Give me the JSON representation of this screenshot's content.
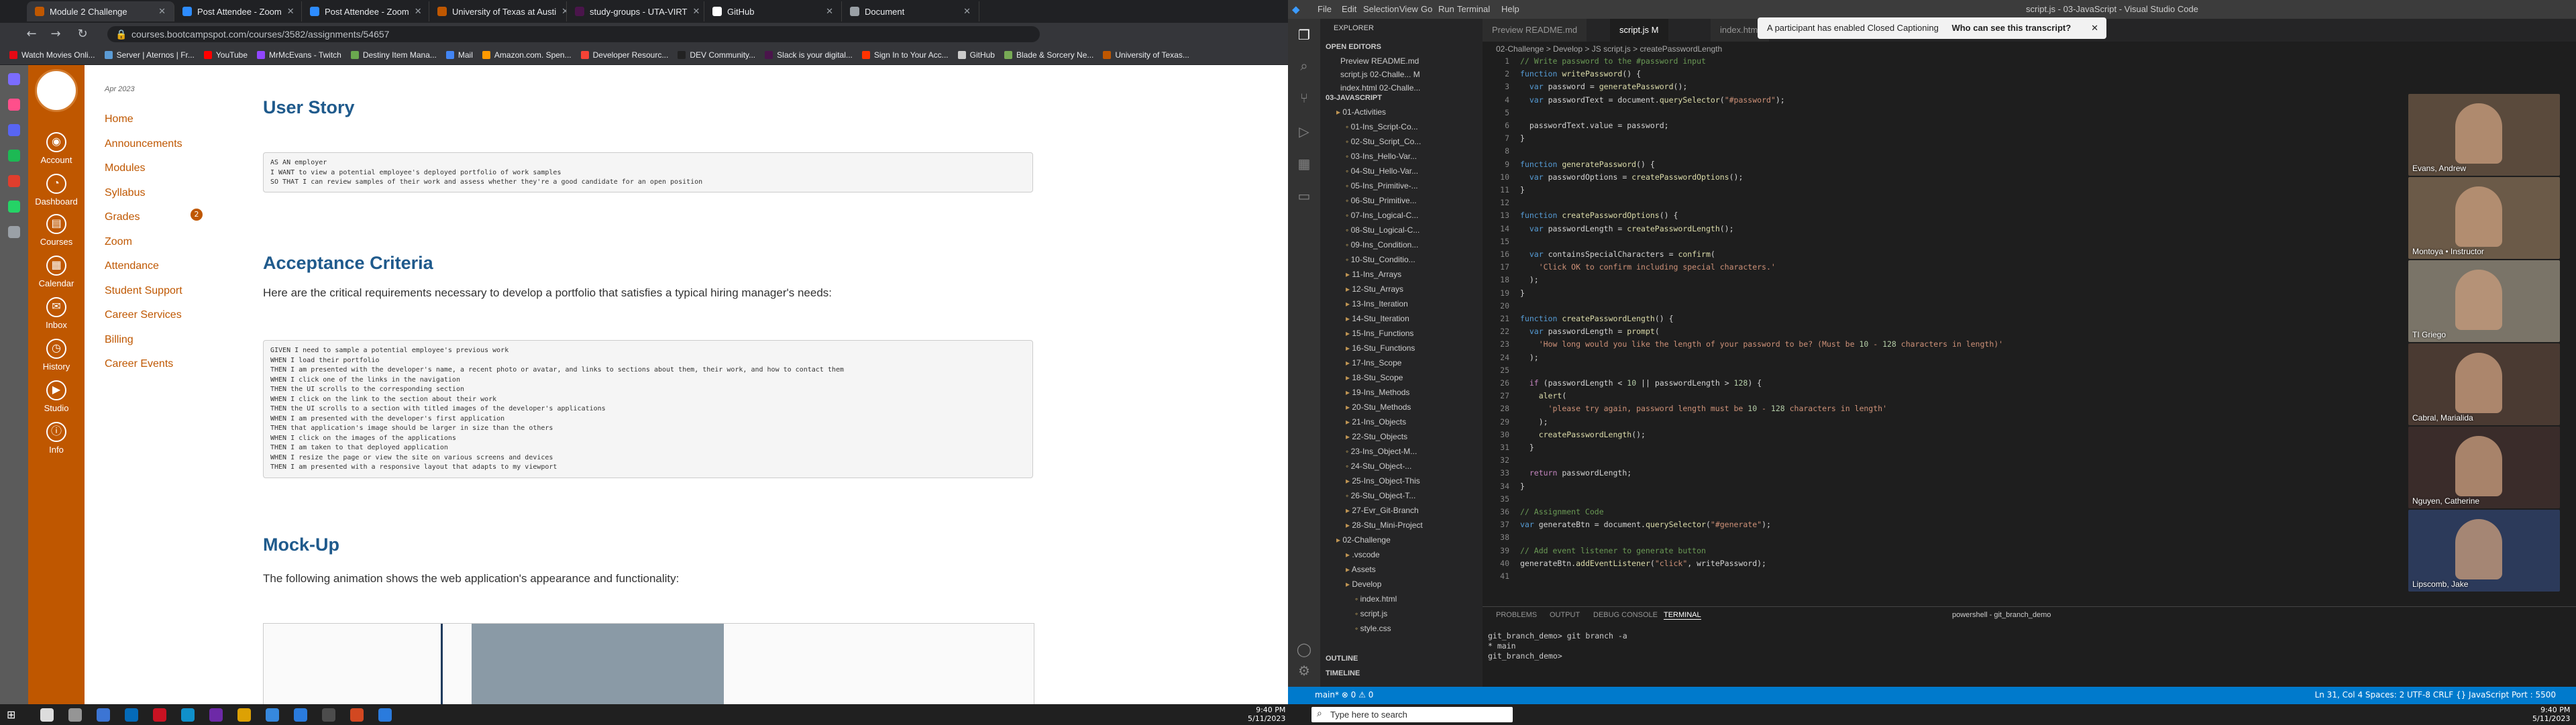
{
  "browser": {
    "tabs": [
      {
        "label": "Module 2 Challenge",
        "color": "#bf5700",
        "active": true
      },
      {
        "label": "Post Attendee - Zoom",
        "color": "#2d8cff"
      },
      {
        "label": "Post Attendee - Zoom",
        "color": "#2d8cff"
      },
      {
        "label": "University of Texas at Austi",
        "color": "#bf5700"
      },
      {
        "label": "study-groups - UTA-VIRT",
        "color": "#4a154b"
      },
      {
        "label": "GitHub",
        "color": "#ffffff"
      },
      {
        "label": "Document",
        "color": "#9aa0a6"
      }
    ],
    "url": "courses.bootcampspot.com/courses/3582/assignments/54657",
    "bookmarks": [
      "Watch Movies Onli...",
      "Server | Aternos | Fr...",
      "YouTube",
      "MrMcEvans - Twitch",
      "Destiny Item Mana...",
      "Mail",
      "Amazon.com. Spen...",
      "Developer Resourc...",
      "DEV Community...",
      "Slack is your digital...",
      "Sign In to Your Acc...",
      "GitHub",
      "Blade & Sorcery Ne...",
      "University of Texas..."
    ]
  },
  "canvas": {
    "global_nav": [
      "Account",
      "Dashboard",
      "Courses",
      "Calendar",
      "Inbox",
      "History",
      "Studio",
      "Info"
    ],
    "term": "Apr 2023",
    "course_nav": [
      "Home",
      "Announcements",
      "Modules",
      "Syllabus",
      "Grades",
      "Zoom",
      "Attendance",
      "Student Support",
      "Career Services",
      "Billing",
      "Career Events"
    ],
    "grades_badge": "2",
    "sections": {
      "user_story_title": "User Story",
      "user_story_code": "AS AN employer\nI WANT to view a potential employee's deployed portfolio of work samples\nSO THAT I can review samples of their work and assess whether they're a good candidate for an open position",
      "acceptance_title": "Acceptance Criteria",
      "acceptance_intro": "Here are the critical requirements necessary to develop a portfolio that satisfies a typical hiring manager's needs:",
      "acceptance_code": "GIVEN I need to sample a potential employee's previous work\nWHEN I load their portfolio\nTHEN I am presented with the developer's name, a recent photo or avatar, and links to sections about them, their work, and how to contact them\nWHEN I click one of the links in the navigation\nTHEN the UI scrolls to the corresponding section\nWHEN I click on the link to the section about their work\nTHEN the UI scrolls to a section with titled images of the developer's applications\nWHEN I am presented with the developer's first application\nTHEN that application's image should be larger in size than the others\nWHEN I click on the images of the applications\nTHEN I am taken to that deployed application\nWHEN I resize the page or view the site on various screens and devices\nTHEN I am presented with a responsive layout that adapts to my viewport",
      "mockup_title": "Mock-Up",
      "mockup_intro": "The following animation shows the web application's appearance and functionality:"
    }
  },
  "vscode": {
    "title": "script.js - 03-JavaScript - Visual Studio Code",
    "menu": [
      "File",
      "Edit",
      "Selection",
      "View",
      "Go",
      "Run",
      "Terminal",
      "Help"
    ],
    "explorer_title": "EXPLORER",
    "open_editors_label": "OPEN EDITORS",
    "open_editors": [
      "Preview README.md",
      "script.js  02-Challe...  M",
      "index.html  02-Challe..."
    ],
    "root_label": "03-JAVASCRIPT",
    "tree": [
      "01-Activities",
      "01-Ins_Script-Co...",
      "02-Stu_Script_Co...",
      "03-Ins_Hello-Var...",
      "04-Stu_Hello-Var...",
      "05-Ins_Primitive-...",
      "06-Stu_Primitive...",
      "07-Ins_Logical-C...",
      "08-Stu_Logical-C...",
      "09-Ins_Condition...",
      "10-Stu_Conditio...",
      "11-Ins_Arrays",
      "12-Stu_Arrays",
      "13-Ins_Iteration",
      "14-Stu_Iteration",
      "15-Ins_Functions",
      "16-Stu_Functions",
      "17-Ins_Scope",
      "18-Stu_Scope",
      "19-Ins_Methods",
      "20-Stu_Methods",
      "21-Ins_Objects",
      "22-Stu_Objects",
      "23-Ins_Object-M...",
      "24-Stu_Object-...",
      "25-Ins_Object-This",
      "26-Stu_Object-T...",
      "27-Evr_Git-Branch",
      "28-Stu_Mini-Project",
      "02-Challenge",
      ".vscode",
      "Assets",
      "Develop",
      "index.html",
      "script.js",
      "style.css"
    ],
    "outline_label": "OUTLINE",
    "timeline_label": "TIMELINE",
    "tabs": [
      "Preview README.md",
      "script.js  M",
      "index.html"
    ],
    "breadcrumb": "02-Challenge > Develop > JS script.js > createPasswordLength",
    "panel_tabs": [
      "PROBLEMS",
      "OUTPUT",
      "DEBUG CONSOLE",
      "TERMINAL"
    ],
    "terminal_label": "powershell - git_branch_demo",
    "terminal_lines": [
      "git_branch_demo> git branch -a",
      "* main",
      "git_branch_demo> "
    ],
    "status_left": "main*   ⊗ 0 ⚠ 0",
    "status_right": "Ln 31, Col 4   Spaces: 2   UTF-8   CRLF   {} JavaScript   Port : 5500",
    "code_lines": [
      "// Write password to the #password input",
      "function writePassword() {",
      "  var password = generatePassword();",
      "  var passwordText = document.querySelector(\"#password\");",
      "",
      "  passwordText.value = password;",
      "}",
      "",
      "function generatePassword() {",
      "  var passwordOptions = createPasswordOptions();",
      "}",
      "",
      "function createPasswordOptions() {",
      "  var passwordLength = createPasswordLength();",
      "",
      "  var containsSpecialCharacters = confirm(",
      "    'Click OK to confirm including special characters.'",
      "  );",
      "}",
      "",
      "function createPasswordLength() {",
      "  var passwordLength = prompt(",
      "    'How long would you like the length of your password to be? (Must be 10 - 128 characters in length)'",
      "  );",
      "",
      "  if (passwordLength < 10 || passwordLength > 128) {",
      "    alert(",
      "      'please try again, password length must be 10 - 128 characters in length'",
      "    );",
      "    createPasswordLength();",
      "  }",
      "",
      "  return passwordLength;",
      "}",
      "",
      "// Assignment Code",
      "var generateBtn = document.querySelector(\"#generate\");",
      "",
      "// Add event listener to generate button",
      "generateBtn.addEventListener(\"click\", writePassword);",
      ""
    ]
  },
  "zoom": {
    "banner": "A participant has enabled Closed Captioning",
    "banner_link": "Who can see this transcript?",
    "participants": [
      "Evans, Andrew",
      "Montoya • Instructor",
      "TI Griego",
      "Cabral, Marialida",
      "Nguyen, Catherine",
      "Lipscomb, Jake"
    ]
  },
  "taskbar": {
    "search_placeholder": "Type here to search",
    "clock_left_time": "9:40 PM",
    "clock_left_date": "5/11/2023",
    "clock_right_time": "9:40 PM",
    "clock_right_date": "5/11/2023"
  }
}
